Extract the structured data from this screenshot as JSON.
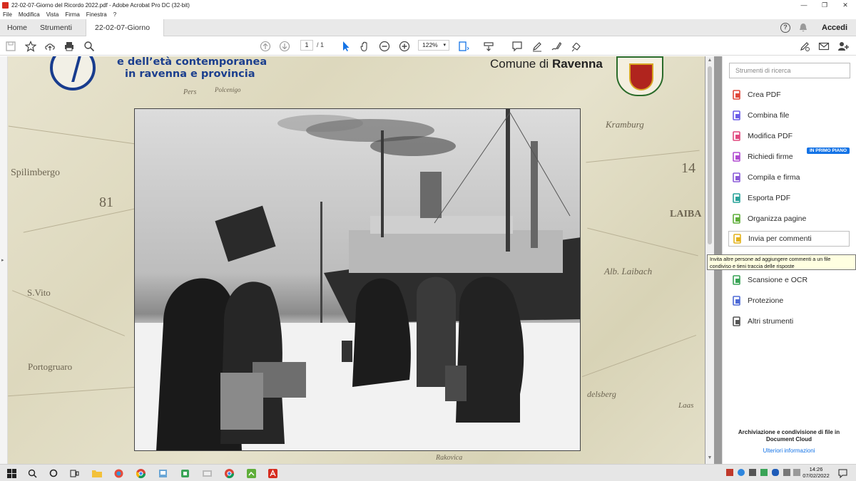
{
  "window": {
    "title": "22-02-07-Giorno del Ricordo 2022.pdf - Adobe Acrobat Pro DC (32-bit)"
  },
  "menu": [
    "File",
    "Modifica",
    "Vista",
    "Firma",
    "Finestra",
    "?"
  ],
  "tabs": {
    "home": "Home",
    "tools": "Strumenti",
    "document": "22-02-07-Giorno d..."
  },
  "account": {
    "signin": "Accedi"
  },
  "toolbar": {
    "page_current": "1",
    "page_total": "/ 1",
    "zoom": "122%"
  },
  "document": {
    "heading_line1": "e dell’età contemporanea",
    "heading_line2": "in ravenna e provincia",
    "comune_prefix": "Comune di",
    "comune_city": "Ravenna",
    "map_labels": [
      "Kramburg",
      "14",
      "LAIBA",
      "Alb. Laibach",
      "Spilimbergo",
      "81",
      "S.Vito",
      "Portogruaro",
      "Pers",
      "Polcenigo",
      "delsberg",
      "Laas",
      "Rakovica"
    ]
  },
  "tools_panel": {
    "search_placeholder": "Strumenti di ricerca",
    "badge": "IN PRIMO PIANO",
    "items": [
      {
        "label": "Crea PDF",
        "color": "#e0483b"
      },
      {
        "label": "Combina file",
        "color": "#6b5ce7"
      },
      {
        "label": "Modifica PDF",
        "color": "#e0487f"
      },
      {
        "label": "Richiedi firme",
        "color": "#b04ad0"
      },
      {
        "label": "Compila e firma",
        "color": "#8a5ad8"
      },
      {
        "label": "Esporta PDF",
        "color": "#2aa39a"
      },
      {
        "label": "Organizza pagine",
        "color": "#5fae3a"
      },
      {
        "label": "Invia per commenti",
        "color": "#e3b21c"
      },
      {
        "label": "Scansione e OCR",
        "color": "#3aa457"
      },
      {
        "label": "Protezione",
        "color": "#4e6ad6"
      },
      {
        "label": "Altri strumenti",
        "color": "#555555"
      }
    ],
    "tooltip": "Invita altre persone ad aggiungere commenti a un file condiviso e tieni traccia delle risposte",
    "cloud_title": "Archiviazione e condivisione di file in Document Cloud",
    "cloud_link": "Ulteriori informazioni"
  },
  "taskbar": {
    "time": "14:26",
    "date": "07/02/2022"
  }
}
